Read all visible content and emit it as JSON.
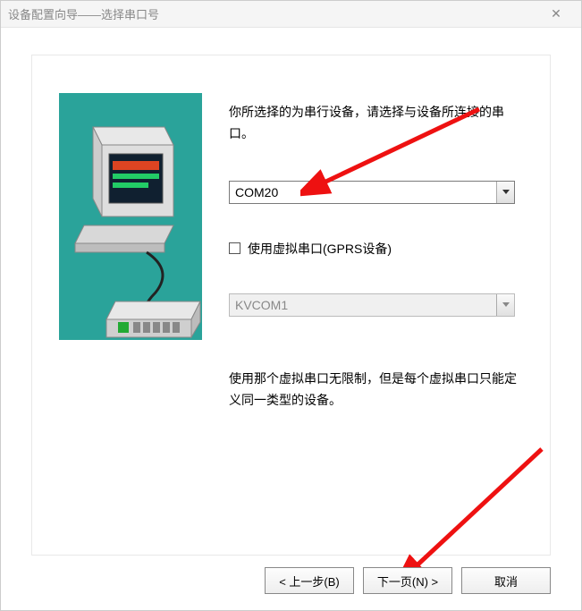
{
  "window": {
    "title": "设备配置向导——选择串口号"
  },
  "main": {
    "instruction": "你所选择的为串行设备，请选择与设备所连接的串口。",
    "com_port": {
      "selected": "COM20"
    },
    "virtual_checkbox_label": "使用虚拟串口(GPRS设备)",
    "virtual_combo": {
      "selected": "KVCOM1"
    },
    "hint": "使用那个虚拟串口无限制，但是每个虚拟串口只能定义同一类型的设备。"
  },
  "buttons": {
    "prev": "< 上一步(B)",
    "next": "下一页(N) >",
    "cancel": "取消"
  }
}
